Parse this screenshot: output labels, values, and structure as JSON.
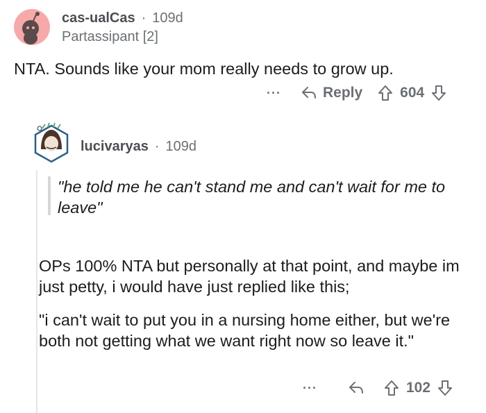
{
  "comment": {
    "username": "cas-ualCas",
    "time": "109d",
    "flair": "Partassipant [2]",
    "text": "NTA. Sounds like your mom really needs to grow up.",
    "more": "···",
    "reply_label": "Reply",
    "votes": "604"
  },
  "reply": {
    "username": "lucivaryas",
    "time": "109d",
    "quote": "\"he told me he can't stand me and can't wait for me to leave\"",
    "paragraph1": "OPs 100% NTA but personally at that point, and maybe im just petty, i would have just replied like this;",
    "paragraph2": "\"i can't wait to put you in a nursing home either, but we're both not getting what we want right now so leave it.\"",
    "more": "···",
    "votes": "102"
  },
  "separator": "·",
  "colors": {
    "avatar_bg": "#f6a9a9",
    "muted": "#6b6f73",
    "quote_bar": "#d7d7d7",
    "hexagon": "#2a5f8a"
  }
}
